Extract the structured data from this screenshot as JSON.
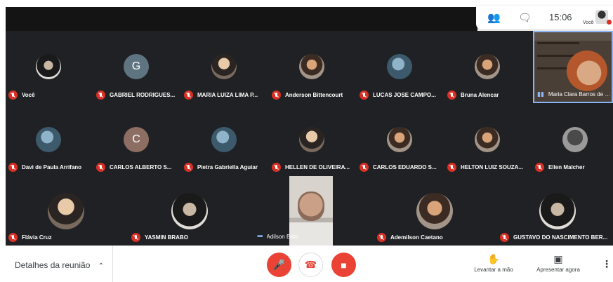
{
  "topbar": {
    "people_icon": "people-icon",
    "chat_icon": "chat-icon",
    "time": "15:06",
    "self_label": "Você"
  },
  "participants": [
    {
      "name": "Você",
      "avatar": "photo"
    },
    {
      "name": "GABRIEL RODRIGUES...",
      "avatar": "G",
      "avatar_color": "#5f7481"
    },
    {
      "name": "MARIA LUIZA LIMA P...",
      "avatar": "photo"
    },
    {
      "name": "Anderson Bittencourt",
      "avatar": "photo"
    },
    {
      "name": "LUCAS JOSE CAMPO...",
      "avatar": "photo"
    },
    {
      "name": "Bruna Alencar",
      "avatar": "photo"
    },
    {
      "name": "Maria Clara Barros de O...",
      "avatar": "video"
    },
    {
      "name": "Davi de Paula Arrifano",
      "avatar": "photo"
    },
    {
      "name": "CARLOS ALBERTO S...",
      "avatar": "C",
      "avatar_color": "#8d6e63"
    },
    {
      "name": "Pietra Gabriella Aguiar",
      "avatar": "photo"
    },
    {
      "name": "HELLEN DE OLIVEIRA...",
      "avatar": "photo"
    },
    {
      "name": "CARLOS EDUARDO S...",
      "avatar": "photo"
    },
    {
      "name": "HELTON LUIZ SOUZA...",
      "avatar": "photo"
    },
    {
      "name": "Ellen Malcher",
      "avatar": "photo"
    },
    {
      "name": "Flávia Cruz",
      "avatar": "photo"
    },
    {
      "name": "YASMIN BRABO",
      "avatar": "photo"
    },
    {
      "name": "Adilson Brito",
      "avatar": "video"
    },
    {
      "name": "Ademilson Caetano",
      "avatar": "photo"
    },
    {
      "name": "GUSTAVO DO NASCIMENTO BER...",
      "avatar": "photo"
    }
  ],
  "bottom": {
    "details_label": "Detalhes da reunião",
    "raise_hand_label": "Levantar a mão",
    "present_label": "Apresentar agora"
  }
}
